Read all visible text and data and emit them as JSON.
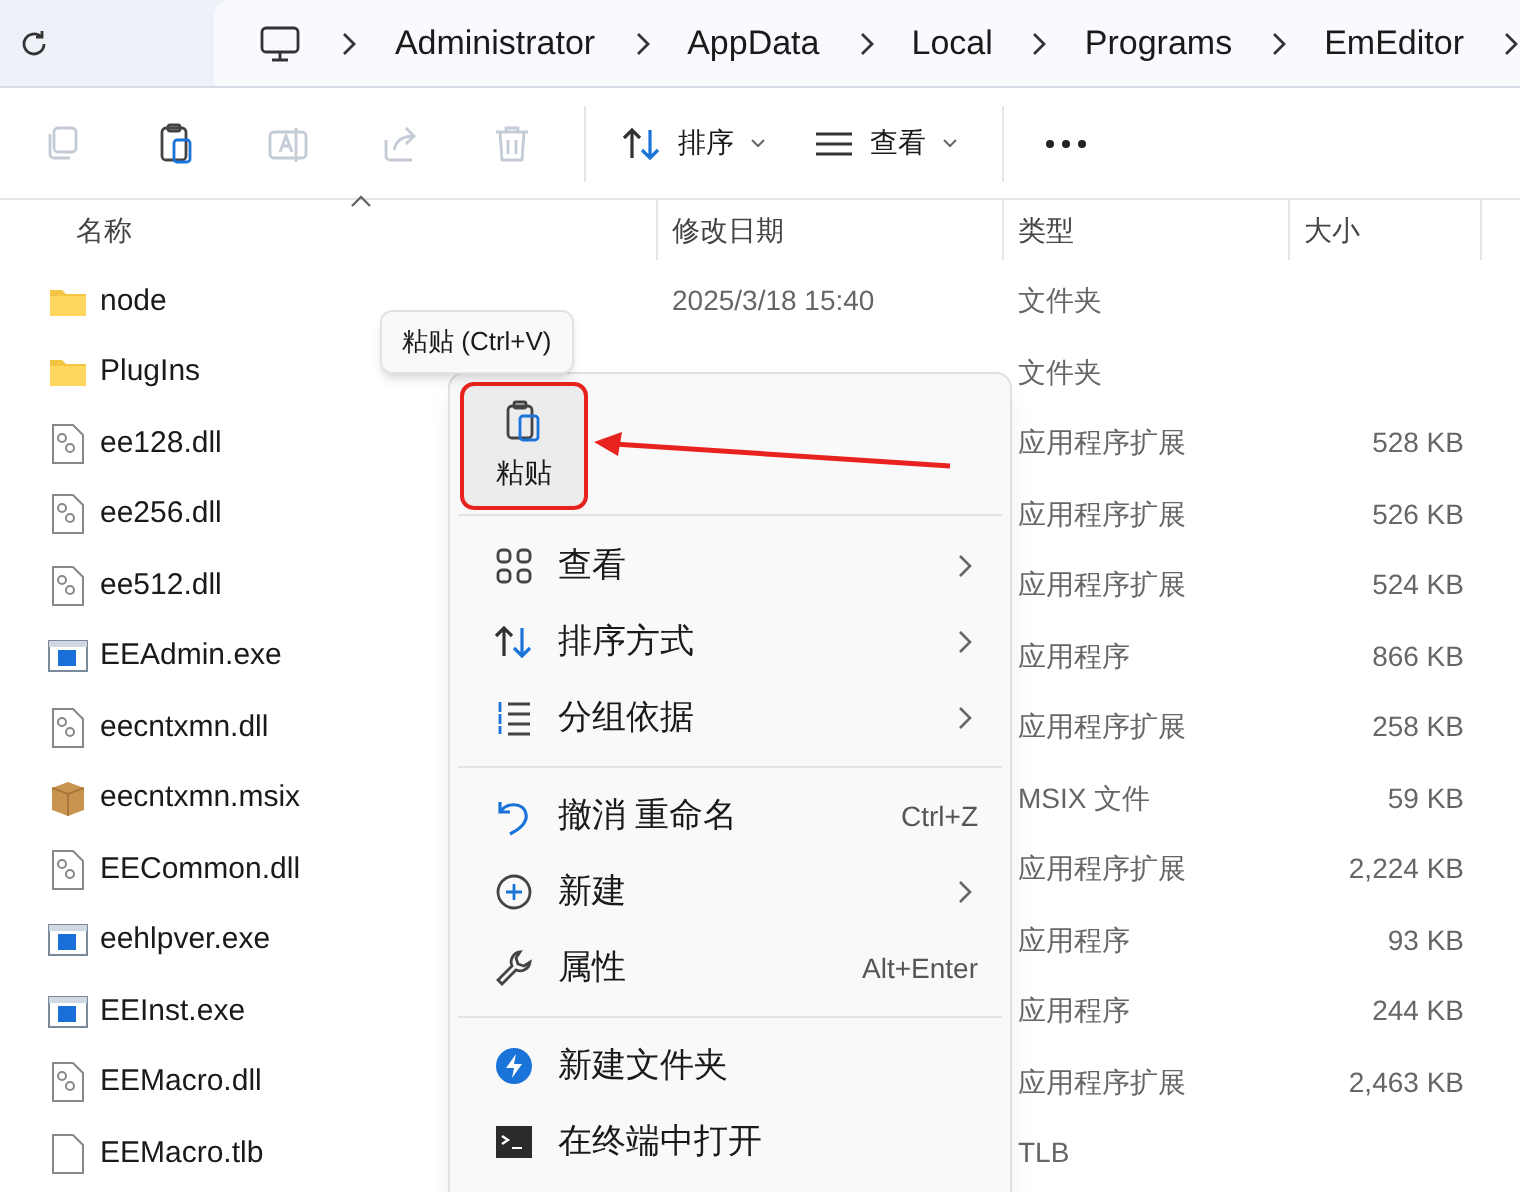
{
  "address_bar": {
    "crumbs": [
      "Administrator",
      "AppData",
      "Local",
      "Programs",
      "EmEditor"
    ]
  },
  "toolbar": {
    "icon_buttons": [
      {
        "kind": "copy",
        "disabled": true
      },
      {
        "kind": "paste",
        "disabled": false
      },
      {
        "kind": "rename",
        "disabled": true
      },
      {
        "kind": "share",
        "disabled": true
      },
      {
        "kind": "delete",
        "disabled": true
      }
    ],
    "sort_button": "排序",
    "view_button": "查看"
  },
  "table": {
    "columns": [
      "名称",
      "修改日期",
      "类型",
      "大小"
    ],
    "rows": [
      {
        "kind": "folder",
        "name": "node",
        "date": "2025/3/18 15:40",
        "type": "文件夹"
      },
      {
        "kind": "folder",
        "name": "PlugIns",
        "type": "文件夹"
      },
      {
        "kind": "dll",
        "name": "ee128.dll",
        "type": "应用程序扩展",
        "size": "528 KB"
      },
      {
        "kind": "dll",
        "name": "ee256.dll",
        "type": "应用程序扩展",
        "size": "526 KB"
      },
      {
        "kind": "dll",
        "name": "ee512.dll",
        "type": "应用程序扩展",
        "size": "524 KB"
      },
      {
        "kind": "exe",
        "name": "EEAdmin.exe",
        "type": "应用程序",
        "size": "866 KB"
      },
      {
        "kind": "dll",
        "name": "eecntxmn.dll",
        "type": "应用程序扩展",
        "size": "258 KB"
      },
      {
        "kind": "package",
        "name": "eecntxmn.msix",
        "type": "MSIX 文件",
        "size": "59 KB"
      },
      {
        "kind": "dll",
        "name": "EECommon.dll",
        "type": "应用程序扩展",
        "size": "2,224 KB"
      },
      {
        "kind": "exe",
        "name": "eehlpver.exe",
        "type": "应用程序",
        "size": "93 KB"
      },
      {
        "kind": "exe",
        "name": "EEInst.exe",
        "type": "应用程序",
        "size": "244 KB"
      },
      {
        "kind": "dll",
        "name": "EEMacro.dll",
        "type": "应用程序扩展",
        "size": "2,463 KB"
      },
      {
        "kind": "file",
        "name": "EEMacro.tlb",
        "type": "TLB"
      }
    ]
  },
  "tooltip": "粘贴 (Ctrl+V)",
  "context_menu": {
    "paste_button": {
      "label": "粘贴",
      "annotated": true
    },
    "groups": [
      [
        {
          "kind": "view",
          "label": "查看",
          "has_submenu": true
        },
        {
          "kind": "sort",
          "label": "排序方式",
          "has_submenu": true
        },
        {
          "kind": "group",
          "label": "分组依据",
          "has_submenu": true
        }
      ],
      [
        {
          "kind": "undo",
          "label": "撤消 重命名",
          "shortcut": "Ctrl+Z",
          "has_submenu": false
        },
        {
          "kind": "new",
          "label": "新建",
          "has_submenu": true
        },
        {
          "kind": "properties",
          "label": "属性",
          "shortcut": "Alt+Enter",
          "has_submenu": false
        }
      ],
      [
        {
          "kind": "new_folder",
          "label": "新建文件夹",
          "has_submenu": false
        },
        {
          "kind": "terminal",
          "label": "在终端中打开",
          "has_submenu": false
        }
      ]
    ]
  }
}
